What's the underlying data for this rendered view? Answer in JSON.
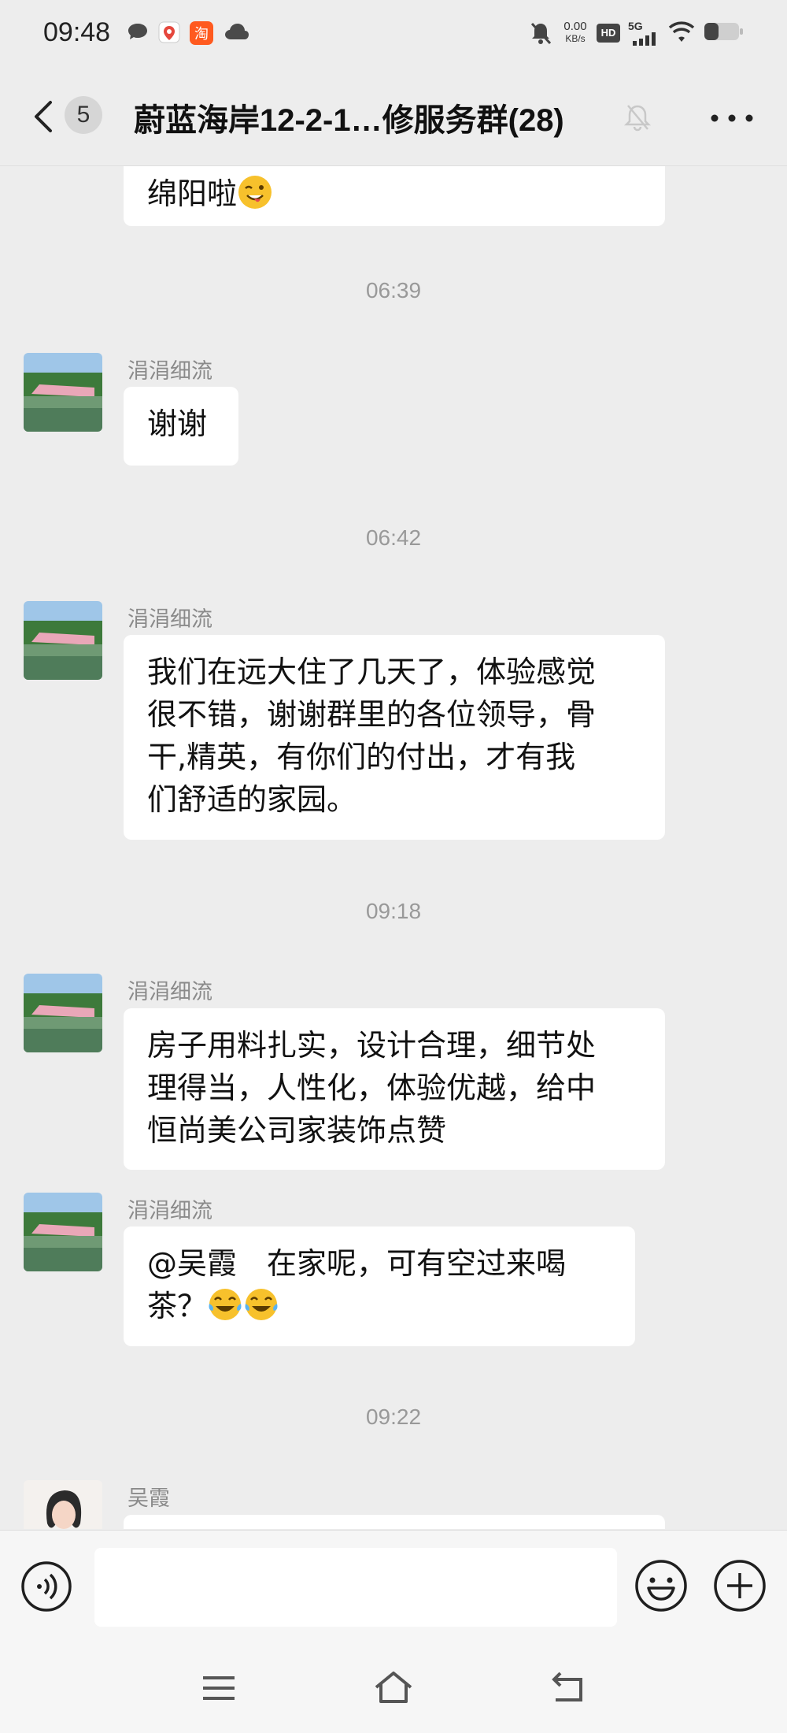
{
  "status_bar": {
    "time": "09:48",
    "net_speed_value": "0.00",
    "net_speed_unit": "KB/s",
    "hd_badge": "HD",
    "network": "5G",
    "app_icons": [
      "message-bubble-icon",
      "map-pin-icon",
      "taobao-icon",
      "cloud-icon"
    ],
    "system_icons": [
      "silent-bell-icon",
      "hd-icon",
      "5g-signal-icon",
      "wifi-icon",
      "battery-icon"
    ]
  },
  "header": {
    "unread_count": "5",
    "title": "蔚蓝海岸12-2-1…修服务群(28)"
  },
  "chat": {
    "messages": [
      {
        "type": "text",
        "text": "绵阳啦",
        "emoji": "wink-tongue-emoji"
      },
      {
        "type": "timestamp",
        "text": "06:39"
      },
      {
        "type": "text",
        "sender": "涓涓细流",
        "text": "谢谢"
      },
      {
        "type": "timestamp",
        "text": "06:42"
      },
      {
        "type": "text",
        "sender": "涓涓细流",
        "lines": [
          "我们在远大住了几天了，体验感觉",
          "很不错，谢谢群里的各位领导，骨",
          "干,精英，有你们的付出，才有我",
          "们舒适的家园。"
        ]
      },
      {
        "type": "timestamp",
        "text": "09:18"
      },
      {
        "type": "text",
        "sender": "涓涓细流",
        "lines": [
          "房子用料扎实，设计合理，细节处",
          "理得当，人性化，体验优越，给中",
          "恒尚美公司家装饰点赞"
        ]
      },
      {
        "type": "text",
        "sender": "涓涓细流",
        "lines": [
          "@吴霞　在家呢，可有空过来喝",
          "茶？"
        ],
        "emoji": "laughing-tears-emoji"
      },
      {
        "type": "timestamp",
        "text": "09:22"
      },
      {
        "type": "text",
        "sender": "吴霞"
      }
    ]
  },
  "input": {
    "value": "",
    "placeholder": ""
  },
  "colors": {
    "background": "#ededed",
    "bubble": "#ffffff",
    "timestamp": "#999999",
    "sender": "#8a8a8a",
    "emoji": "#f7c12c"
  }
}
